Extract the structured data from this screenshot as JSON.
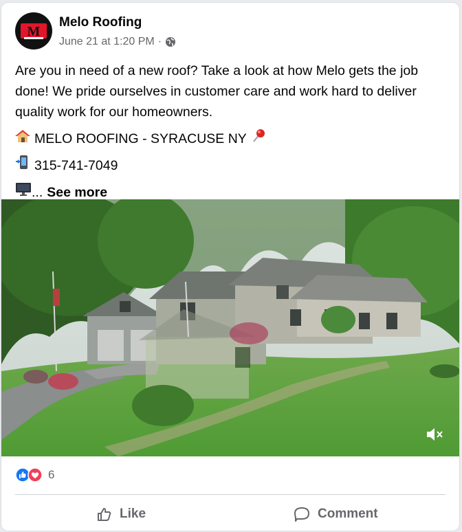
{
  "post": {
    "page_name": "Melo Roofing",
    "timestamp": "June 21 at 1:20 PM",
    "separator": "·",
    "privacy_icon": "globe-icon",
    "text": "Are you in need of a new roof? Take a look at how Melo gets the job done! We pride ourselves in customer care and work hard to deliver quality work for our homeowners.",
    "location_line": "MELO ROOFING - SYRACUSE NY",
    "phone_line": "315-741-7049",
    "ellipsis": "...",
    "see_more": "See more",
    "avatar_logo_text": "M"
  },
  "reactions": {
    "count": "6",
    "types": [
      "like",
      "love"
    ]
  },
  "actions": {
    "like_label": "Like",
    "comment_label": "Comment"
  },
  "colors": {
    "like_blue": "#1877f2",
    "love_red": "#f33e58",
    "meta_gray": "#65676b",
    "logo_red": "#e4152a"
  }
}
